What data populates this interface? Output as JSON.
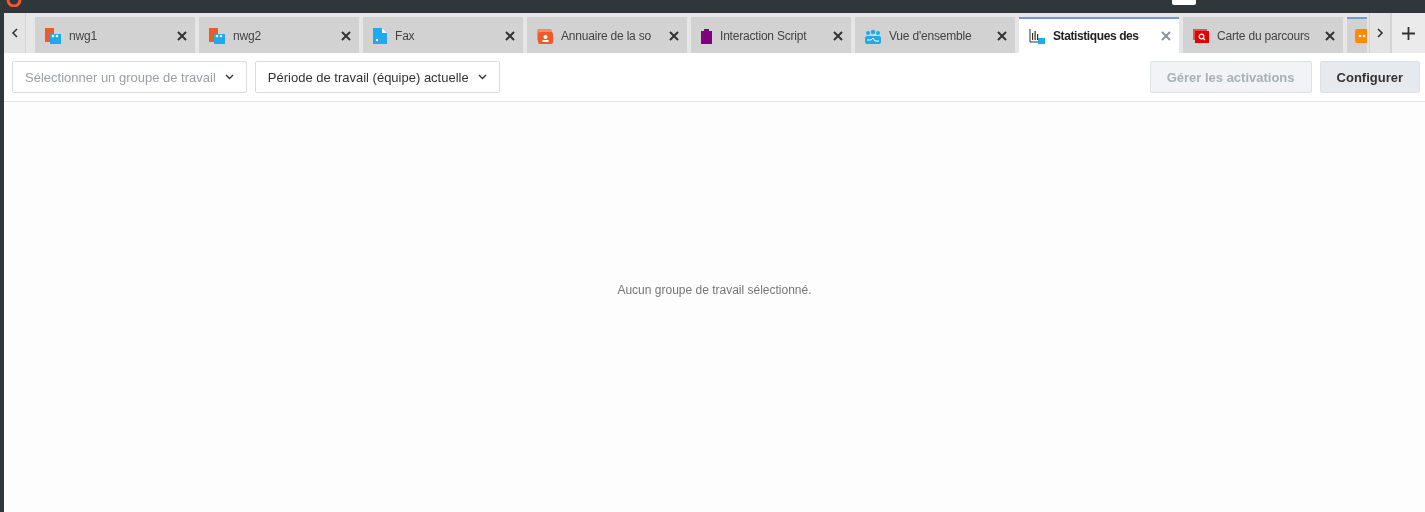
{
  "tabs": [
    {
      "label": "nwg1",
      "kind": "workgroup",
      "selected": false
    },
    {
      "label": "nwg2",
      "kind": "workgroup",
      "selected": false
    },
    {
      "label": "Fax",
      "kind": "fax",
      "selected": false
    },
    {
      "label": "Annuaire de la so",
      "kind": "directory",
      "selected": false
    },
    {
      "label": "Interaction Script",
      "kind": "clipboard",
      "selected": false
    },
    {
      "label": "Vue d'ensemble",
      "kind": "team",
      "selected": false
    },
    {
      "label": "Statistiques des",
      "kind": "stats",
      "selected": true
    },
    {
      "label": "Carte du parcours",
      "kind": "journey",
      "selected": false
    },
    {
      "kind": "more",
      "selected": false
    }
  ],
  "toolbar": {
    "workgroup_select": {
      "placeholder": "Sélectionner un groupe de travail"
    },
    "period_select": {
      "value": "Période de travail (équipe) actuelle"
    },
    "buttons": [
      {
        "label": "Gérer les activations",
        "disabled": true
      },
      {
        "label": "Configurer",
        "disabled": false
      }
    ]
  },
  "empty_message": "Aucun groupe de travail sélectionné."
}
